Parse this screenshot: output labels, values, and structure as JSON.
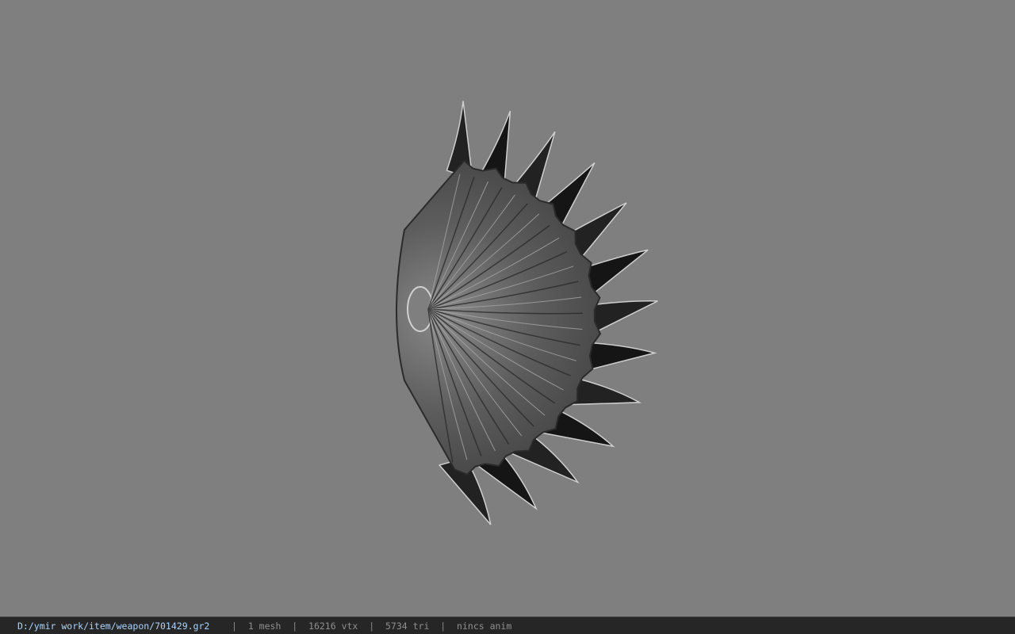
{
  "viewport": {
    "background": "#7f7f7f",
    "model": {
      "description_icon": "spiked-wing-fan-weapon-mesh",
      "shade_dark": "#1a1a1a",
      "shade_mid": "#5a5a5a",
      "shade_light": "#b5b5b5"
    }
  },
  "statusbar": {
    "file_path": "D:/ymir work/item/weapon/701429.gr2",
    "separator": "|",
    "mesh_count": "1 mesh",
    "vertex_count": "16216 vtx",
    "triangle_count": "5734 tri",
    "anim_info": "nincs anim",
    "path_color": "#a9d4ff",
    "text_color": "#8f8f8f"
  }
}
